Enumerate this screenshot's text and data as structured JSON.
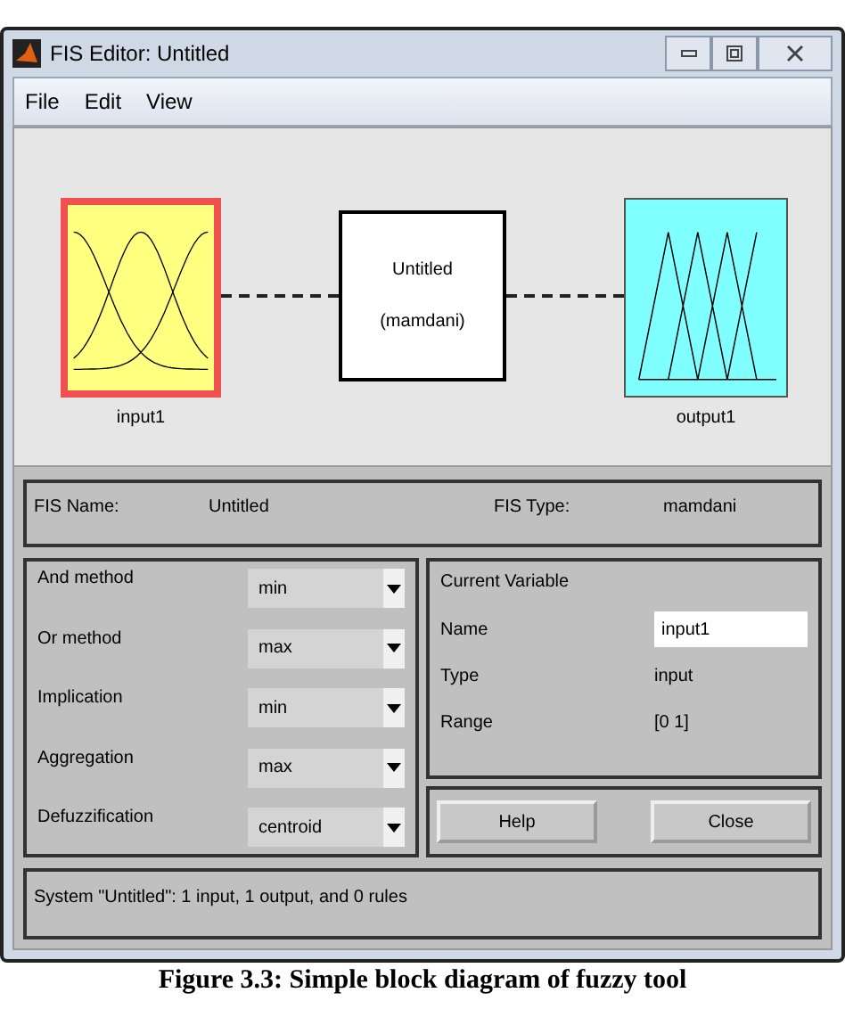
{
  "window": {
    "title": "FIS Editor: Untitled"
  },
  "menu": [
    "File",
    "Edit",
    "View"
  ],
  "diagram": {
    "input": {
      "label": "input1",
      "selected": true
    },
    "system": {
      "name": "Untitled",
      "type": "(mamdani)"
    },
    "output": {
      "label": "output1",
      "selected": false
    }
  },
  "fis_info": [
    {
      "label": "FIS Name:",
      "value": "Untitled"
    },
    {
      "label": "FIS Type:",
      "value": "mamdani"
    }
  ],
  "methods": [
    {
      "label": "And method",
      "value": "min"
    },
    {
      "label": "Or method",
      "value": "max"
    },
    {
      "label": "Implication",
      "value": "min"
    },
    {
      "label": "Aggregation",
      "value": "max"
    },
    {
      "label": "Defuzzification",
      "value": "centroid"
    }
  ],
  "current_variable": {
    "title": "Current Variable",
    "rows": [
      {
        "label": "Name",
        "value": "input1",
        "kind": "field"
      },
      {
        "label": "Type",
        "value": "input",
        "kind": "text"
      },
      {
        "label": "Range",
        "value": "[0 1]",
        "kind": "text"
      }
    ]
  },
  "buttons": [
    "Help",
    "Close"
  ],
  "status_bar": "System \"Untitled\": 1 input, 1 output, and 0 rules",
  "caption": "Figure 3.3: Simple block diagram of fuzzy tool"
}
